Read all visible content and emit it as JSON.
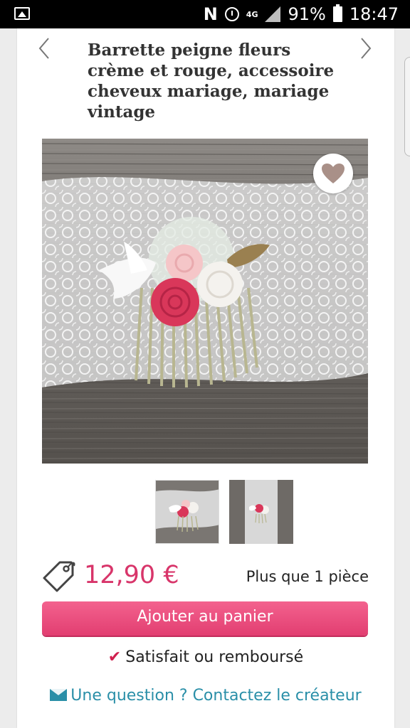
{
  "status_bar": {
    "carrier_glyph": "N",
    "network": "4G",
    "battery": "91%",
    "time": "18:47",
    "icons": [
      "gallery-icon",
      "notification-n-icon",
      "alarm-icon",
      "network-4g-icon",
      "signal-icon",
      "battery-icon"
    ]
  },
  "product": {
    "title": "Barrette peigne fleurs crème et rouge, accessoire cheveux mariage, mariage vintage",
    "price": "12,90 €",
    "stock": "Plus que 1 pièce",
    "thumbnails_count": 2
  },
  "actions": {
    "add_to_cart": "Ajouter au panier",
    "guarantee": "Satisfait ou remboursé",
    "contact": "Une question ? Contactez le créateur"
  },
  "colors": {
    "accent_pink": "#d8356a",
    "button_pink": "#ec4f7f",
    "link_teal": "#2a8fa8",
    "heart_taupe": "#a99088"
  }
}
